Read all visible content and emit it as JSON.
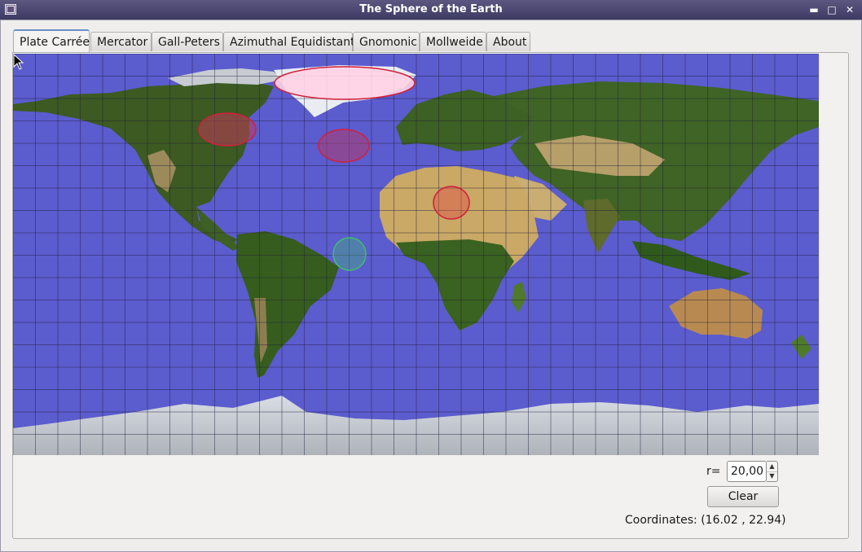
{
  "window": {
    "title": "The Sphere of the Earth"
  },
  "tabs": [
    {
      "label": "Plate Carrée",
      "active": true
    },
    {
      "label": "Mercator",
      "active": false
    },
    {
      "label": "Gall-Peters",
      "active": false
    },
    {
      "label": "Azimuthal Equidistant",
      "active": false
    },
    {
      "label": "Gnomonic",
      "active": false
    },
    {
      "label": "Mollweide",
      "active": false
    },
    {
      "label": "About",
      "active": false
    }
  ],
  "controls": {
    "radius_label": "r=",
    "radius_value": "20,00",
    "clear_label": "Clear",
    "coordinates_text": "Coordinates: (16.02 , 22.94)"
  },
  "colors": {
    "ocean": "#5b5cce",
    "circle_red": "#d0203a",
    "circle_green": "#3ec06a",
    "titlebar": "#4a466e"
  },
  "icons": [
    "app-icon",
    "minimize-icon",
    "maximize-icon",
    "close-icon",
    "spin-up-icon",
    "spin-down-icon",
    "mouse-pointer-icon"
  ]
}
